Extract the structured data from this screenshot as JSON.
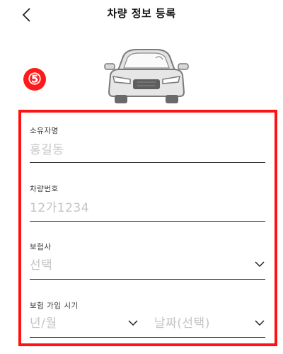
{
  "header": {
    "title": "차량 정보 등록"
  },
  "badge": "⑤",
  "form": {
    "owner": {
      "label": "소유자명",
      "placeholder": "홍길동"
    },
    "plate": {
      "label": "차량번호",
      "placeholder": "12가1234"
    },
    "insurer": {
      "label": "보험사",
      "value": "선택"
    },
    "join_date": {
      "label": "보험 가입 시기",
      "year_month": "년/월",
      "day": "날짜(선택)"
    }
  },
  "colors": {
    "highlight": "#ff1212",
    "placeholder": "#c4c4c4"
  },
  "icons": {
    "back": "chevron-left-icon",
    "car": "car-front-icon",
    "dropdown": "chevron-down-icon"
  }
}
